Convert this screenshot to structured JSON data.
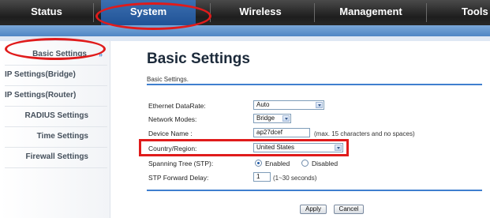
{
  "nav": {
    "tabs": [
      {
        "label": "Status"
      },
      {
        "label": "System"
      },
      {
        "label": "Wireless"
      },
      {
        "label": "Management"
      },
      {
        "label": "Tools"
      }
    ]
  },
  "sidebar": {
    "items": [
      {
        "label": "Basic Settings",
        "chevron": "»"
      },
      {
        "label": "IP Settings(Bridge)"
      },
      {
        "label": "IP Settings(Router)"
      },
      {
        "label": "RADIUS Settings"
      },
      {
        "label": "Time Settings"
      },
      {
        "label": "Firewall Settings"
      }
    ]
  },
  "main": {
    "title": "Basic Settings",
    "subtitle": "Basic Settings.",
    "fields": {
      "ethernet_datarate": {
        "label": "Ethernet DataRate:",
        "value": "Auto"
      },
      "network_modes": {
        "label": "Network Modes:",
        "value": "Bridge"
      },
      "device_name": {
        "label": "Device Name :",
        "value": "ap27dcef",
        "hint": "(max. 15 characters and no spaces)"
      },
      "country_region": {
        "label": "Country/Region:",
        "value": "United States"
      },
      "spanning_tree": {
        "label": "Spanning Tree (STP):",
        "options": [
          "Enabled",
          "Disabled"
        ],
        "selected": "Enabled"
      },
      "stp_forward_delay": {
        "label": "STP Forward Delay:",
        "value": "1",
        "hint": "(1~30 seconds)"
      }
    },
    "buttons": {
      "apply": "Apply",
      "cancel": "Cancel"
    }
  },
  "colors": {
    "annotation": "#e01b1b",
    "accent": "#3f7fcf"
  }
}
